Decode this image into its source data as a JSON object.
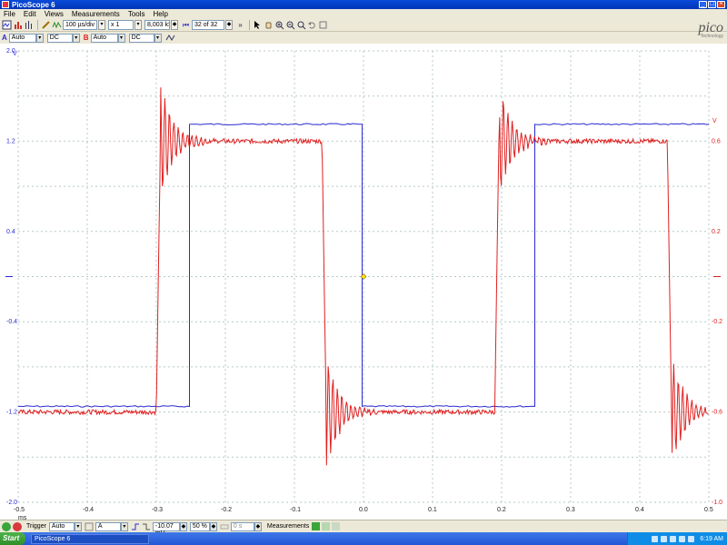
{
  "window": {
    "title": "PicoScope 6",
    "min_glyph": "_",
    "max_glyph": "□",
    "close_glyph": "×"
  },
  "menu": [
    "File",
    "Edit",
    "Views",
    "Measurements",
    "Tools",
    "Help"
  ],
  "toolbar": {
    "timebase": "100 µs/div",
    "zoom": "x 1",
    "samples": "8,003 kS",
    "buffer": "32 of 32",
    "spin_glyph": "◆",
    "first_glyph": "⏮",
    "skip_glyph": "»"
  },
  "channels": [
    {
      "letter": "A",
      "range": "Auto",
      "coupling": "DC",
      "color": "#2a2ad0"
    },
    {
      "letter": "B",
      "range": "Auto",
      "coupling": "DC",
      "color": "#e02020"
    }
  ],
  "logo": {
    "name": "pico",
    "tagline": "Technology"
  },
  "icons": {
    "scope": "scope-mode-icon",
    "spectrum": "spectrum-mode-icon",
    "persist": "persistence-mode-icon",
    "probe": "probe-icon",
    "signal": "signal-generator-icon",
    "pointer": "pointer-tool-icon",
    "hand": "hand-tool-icon",
    "zoom_in": "zoom-in-icon",
    "zoom_out": "zoom-out-icon",
    "zoom_fit": "zoom-fit-icon",
    "undo": "undo-icon",
    "zoom_undo": "zoom-undo-icon"
  },
  "chart_data": {
    "type": "line",
    "xlabel": "ms",
    "x_ticks": [
      "-0.5",
      "-0.4",
      "-0.3",
      "-0.2",
      "-0.1",
      "0.0",
      "0.1",
      "0.2",
      "0.3",
      "0.4",
      "0.5"
    ],
    "xlim": [
      -0.5,
      0.5
    ],
    "grid": true,
    "left_axis": {
      "unit": "V",
      "ticks": [
        "2.0",
        "1.2",
        "0.4",
        "-0.4",
        "-1.2",
        "-2.0"
      ],
      "ylim": [
        -2.0,
        2.0
      ],
      "color": "#2a2ad0"
    },
    "right_axis": {
      "unit": "V",
      "ticks": [
        "0.6",
        "0.2",
        "-0.2",
        "-0.6",
        "-1.0"
      ],
      "ylim": [
        -1.0,
        1.0
      ],
      "color": "#e02020"
    },
    "series": [
      {
        "channel": "A",
        "color": "#2a2ad0",
        "axis": "left",
        "shape": "square",
        "x": [
          -0.5,
          -0.252,
          -0.252,
          -0.002,
          -0.002,
          0.248,
          0.248,
          0.5
        ],
        "y": [
          -1.15,
          -1.15,
          1.35,
          1.35,
          -1.15,
          -1.15,
          1.35,
          1.35
        ]
      },
      {
        "channel": "B",
        "color": "#e02020",
        "axis": "right",
        "shape": "ringing-square",
        "x": [
          -0.5,
          -0.3,
          -0.3,
          -0.06,
          -0.06,
          0.19,
          0.19,
          0.44,
          0.44,
          0.5
        ],
        "y": [
          -0.6,
          -0.6,
          0.6,
          0.6,
          -0.6,
          -0.6,
          0.6,
          0.6,
          -0.6,
          -0.6
        ]
      }
    ],
    "trigger_marker": {
      "x": 0.0,
      "y": 0.0
    }
  },
  "bottom": {
    "trigger_label": "Trigger",
    "trigger_mode": "Auto",
    "trigger_source": "A",
    "threshold": "-10.07 mV",
    "pretrigger": "50 %",
    "delay": "0 s",
    "measurements_label": "Measurements"
  },
  "taskbar": {
    "start": "Start",
    "task": "PicoScope 6",
    "clock": "6:19 AM"
  }
}
